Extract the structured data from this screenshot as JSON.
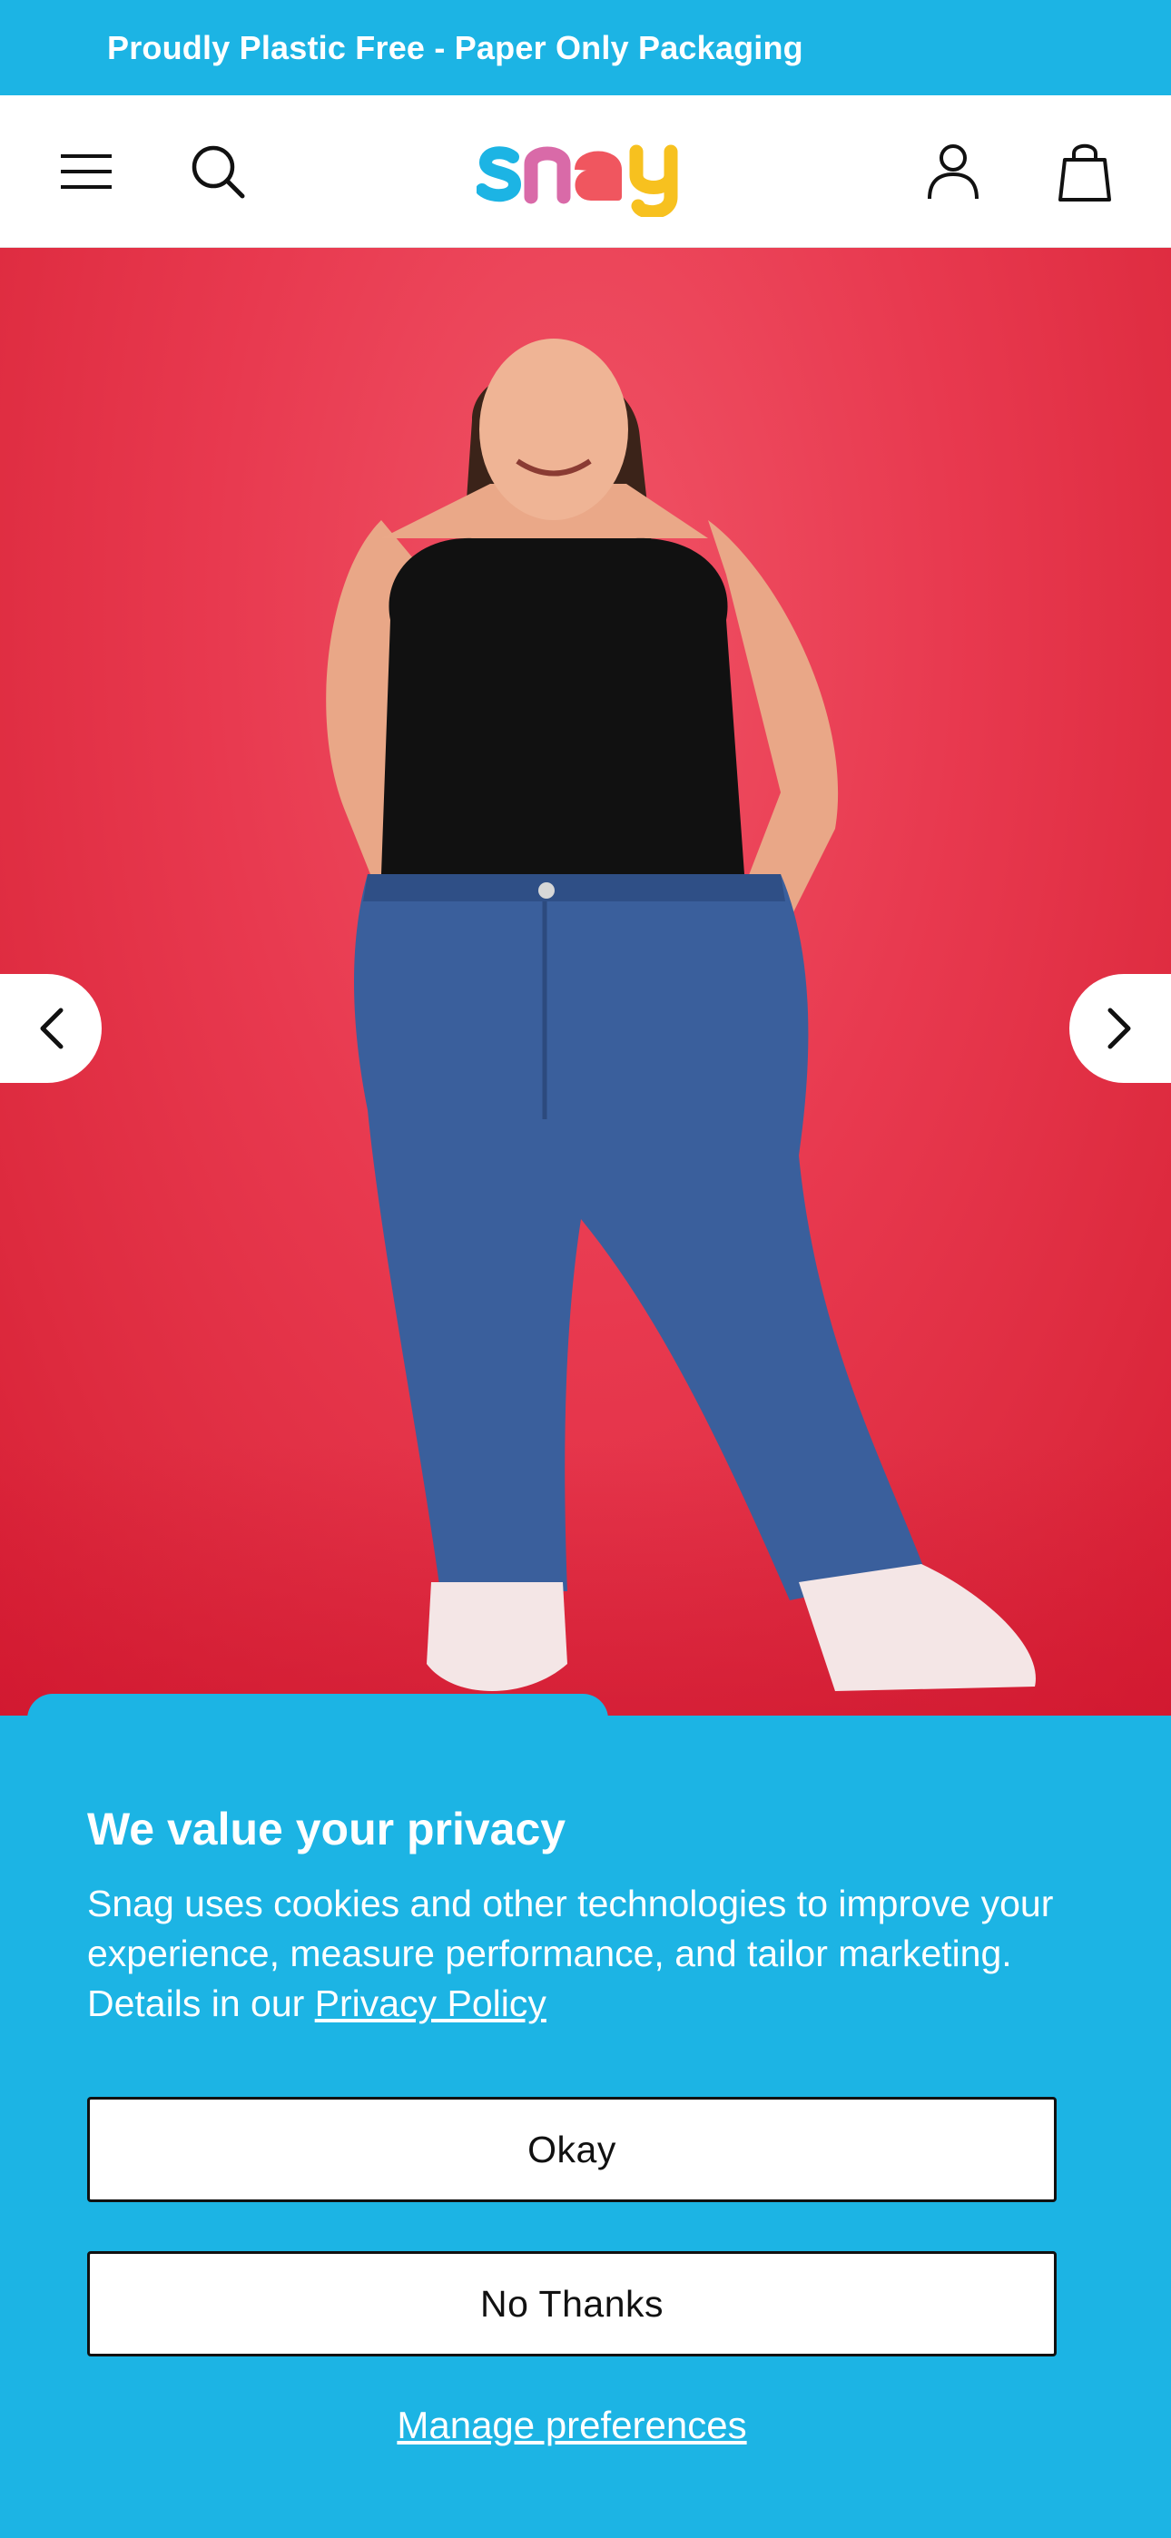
{
  "announcement": {
    "text": "Proudly Plastic Free - Paper Only Packaging"
  },
  "header": {
    "logo_text": "snag",
    "icons": [
      "menu-icon",
      "search-icon",
      "account-icon",
      "bag-icon"
    ]
  },
  "hero": {
    "image_description_name": "model-photo",
    "prev_icon": "chevron-left-icon",
    "next_icon": "chevron-right-icon"
  },
  "cookie": {
    "title": "We value your privacy",
    "body": "Snag uses cookies and other technologies to improve your experience, measure performance, and tailor marketing. Details in our ",
    "link": "Privacy Policy",
    "okay": "Okay",
    "no_thanks": "No Thanks",
    "manage": "Manage preferences"
  },
  "colors": {
    "brand_blue": "#1cb4e4",
    "hero_red": "#e8394f",
    "logo_s": "#1cb4e4",
    "logo_n": "#d96aa8",
    "logo_a": "#f0565f",
    "logo_g": "#f7c11f"
  }
}
